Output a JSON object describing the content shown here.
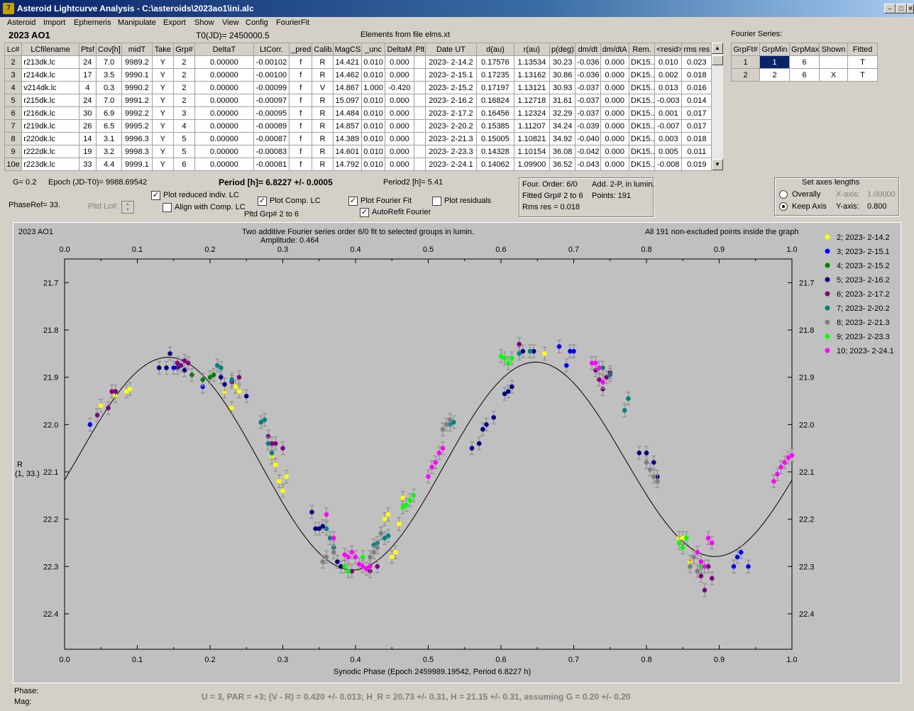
{
  "window": {
    "title": "Asteroid Lightcurve Analysis - C:\\asteroids\\2023ao1\\ini.alc",
    "icon_letter": "7"
  },
  "menu": [
    "Asteroid",
    "Import",
    "Ephemeris",
    "Manipulate",
    "Export",
    "Show",
    "View",
    "Config",
    "FourierFit"
  ],
  "header": {
    "object": "2023 AO1",
    "t0": "T0(JD)= 2450000.5",
    "elements": "Elements from file elms.xt"
  },
  "lc_table": {
    "columns": [
      "Lc#",
      "LCfilename",
      "Ptsf",
      "Cov[h]",
      "midT",
      "Take",
      "Grp#",
      "DeltaT",
      "LtCorr.",
      "_pred.",
      "Calib.",
      "MagCS",
      "_unc",
      "DeltaM",
      "Plt",
      "Date UT",
      "d(au)",
      "r(au)",
      "p(deg)",
      "dm/dt",
      "dm/dtA",
      "Rem.",
      "<resid>",
      "rms res"
    ],
    "rows": [
      [
        "2",
        "r213dk.lc",
        "24",
        "7.0",
        "9989.2",
        "Y",
        "2",
        "0.00000",
        "-0.00102",
        "f",
        "R",
        "14.421",
        "0.010",
        "0.000",
        "",
        "2023- 2-14.2",
        "0.17576",
        "1.13534",
        "30.23",
        "-0.036",
        "0.000",
        "DK15..",
        "0.010",
        "0.023"
      ],
      [
        "3",
        "r214dk.lc",
        "17",
        "3.5",
        "9990.1",
        "Y",
        "2",
        "0.00000",
        "-0.00100",
        "f",
        "R",
        "14.462",
        "0.010",
        "0.000",
        "",
        "2023- 2-15.1",
        "0.17235",
        "1.13162",
        "30.86",
        "-0.036",
        "0.000",
        "DK15..",
        "0.002",
        "0.018"
      ],
      [
        "4",
        "v214dk.lc",
        "4",
        "0.3",
        "9990.2",
        "Y",
        "2",
        "0.00000",
        "-0.00099",
        "f",
        "V",
        "14.867",
        "1.000",
        "-0.420",
        "",
        "2023- 2-15.2",
        "0.17197",
        "1.13121",
        "30.93",
        "-0.037",
        "0.000",
        "DK15..",
        "0.013",
        "0.016"
      ],
      [
        "5",
        "r215dk.lc",
        "24",
        "7.0",
        "9991.2",
        "Y",
        "2",
        "0.00000",
        "-0.00097",
        "f",
        "R",
        "15.097",
        "0.010",
        "0.000",
        "",
        "2023- 2-16.2",
        "0.16824",
        "1.12718",
        "31.61",
        "-0.037",
        "0.000",
        "DK15..",
        "-0.003",
        "0.014"
      ],
      [
        "6",
        "r216dk.lc",
        "30",
        "6.9",
        "9992.2",
        "Y",
        "3",
        "0.00000",
        "-0.00095",
        "f",
        "R",
        "14.484",
        "0.010",
        "0.000",
        "",
        "2023- 2-17.2",
        "0.16456",
        "1.12324",
        "32.29",
        "-0.037",
        "0.000",
        "DK15..",
        "0.001",
        "0.017"
      ],
      [
        "7",
        "r219dk.lc",
        "26",
        "6.5",
        "9995.2",
        "Y",
        "4",
        "0.00000",
        "-0.00089",
        "f",
        "R",
        "14.857",
        "0.010",
        "0.000",
        "",
        "2023- 2-20.2",
        "0.15385",
        "1.11207",
        "34.24",
        "-0.039",
        "0.000",
        "DK15..",
        "-0.007",
        "0.017"
      ],
      [
        "8",
        "r220dk.lc",
        "14",
        "3.1",
        "9996.3",
        "Y",
        "5",
        "0.00000",
        "-0.00087",
        "f",
        "R",
        "14.389",
        "0.010",
        "0.000",
        "",
        "2023- 2-21.3",
        "0.15005",
        "1.10821",
        "34.92",
        "-0.040",
        "0.000",
        "DK15..",
        "0.003",
        "0.018"
      ],
      [
        "9",
        "r222dk.lc",
        "19",
        "3.2",
        "9998.3",
        "Y",
        "5",
        "0.00000",
        "-0.00083",
        "f",
        "R",
        "14.601",
        "0.010",
        "0.000",
        "",
        "2023- 2-23.3",
        "0.14328",
        "1.10154",
        "36.08",
        "-0.042",
        "0.000",
        "DK15..",
        "0.005",
        "0.011"
      ],
      [
        "10e",
        "r223dk.lc",
        "33",
        "4.4",
        "9999.1",
        "Y",
        "6",
        "0.00000",
        "-0.00081",
        "f",
        "R",
        "14.792",
        "0.010",
        "0.000",
        "",
        "2023- 2-24.1",
        "0.14062",
        "1.09900",
        "36.52",
        "-0.043",
        "0.000",
        "DK15..",
        "-0.008",
        "0.019"
      ]
    ]
  },
  "fourier_table": {
    "title": "Fourier Series:",
    "columns": [
      "GrpFt#",
      "GrpMin",
      "GrpMax",
      "Shown",
      "Fitted"
    ],
    "rows": [
      [
        "1",
        "1",
        "6",
        "",
        "T"
      ],
      [
        "2",
        "2",
        "6",
        "X",
        "T"
      ]
    ]
  },
  "params": {
    "g": "G= 0.2",
    "epoch": "Epoch (JD-T0)= 9988.69542",
    "period": "Period [h]= 6.8227 +/- 0.0005",
    "period2": "Period2 [h]= 5.41",
    "phaseref": "PhaseRef= 33.",
    "pltd_lc": "Pltd Lc#:"
  },
  "checkboxes": {
    "plot_reduced": {
      "label": "Plot reduced indiv. LC",
      "checked": true
    },
    "align_comp": {
      "label": "Align with Comp. LC",
      "checked": false
    },
    "plot_comp": {
      "label": "Plot Comp. LC",
      "checked": true
    },
    "plot_fourier": {
      "label": "Plot Fourier Fit",
      "checked": true
    },
    "plot_residuals": {
      "label": "Plot residuals",
      "checked": false
    },
    "autorefit": {
      "label": "AutoRefit Fourier",
      "checked": true
    }
  },
  "pltd_grp": "Pltd Grp#  2  to   6",
  "fit_info": {
    "line1a": "Four. Order:  6/0",
    "line1b": "Add. 2-P, in lumin.",
    "line2a": "Fitted Grp# 2 to 6",
    "line2b": "Points: 191",
    "line3": "Rms res      = 0.018"
  },
  "axes_box": {
    "title": "Set axes lengths",
    "overall": "Overally",
    "keep": "Keep Axis",
    "x_label": "X-axis:",
    "x_value": "1.00000",
    "y_label": "Y-axis:",
    "y_value": "0.800"
  },
  "plot": {
    "name": "2023 AO1",
    "caption": "Two additive Fourier series order 6/0 fit to selected groups in lumin.",
    "amplitude": "Amplitude: 0.464",
    "points_note": "All 191 non-excluded points inside the graph",
    "xlabel": "Synodic Phase (Epoch 2459989.19542, Period 6.8227 h)",
    "ylabel_1": "R",
    "ylabel_2": "(1, 33.)"
  },
  "footer": {
    "phase": "Phase:",
    "mag": "Mag:",
    "summary": "U = 3, PAR = +3; (V - R) = 0.420 +/- 0.013; H_R = 20.73 +/- 0.31, H = 21.15 +/- 0.31, assuming G = 0.20 +/- 0.20"
  },
  "chart_data": {
    "type": "scatter",
    "x_ticks": [
      "0.0",
      "0.1",
      "0.2",
      "0.3",
      "0.4",
      "0.5",
      "0.6",
      "0.7",
      "0.8",
      "0.9",
      "1.0"
    ],
    "y_ticks": [
      "21.7",
      "21.8",
      "21.9",
      "22.0",
      "22.1",
      "22.2",
      "22.3",
      "22.4"
    ],
    "xlim": [
      0,
      1
    ],
    "ylim": [
      22.475,
      21.65
    ],
    "y_inverted": true,
    "legend_position": "right",
    "series": [
      {
        "name": "2; 2023- 2-14.2",
        "color": "#ffff00",
        "points": [
          [
            0.05,
            21.96
          ],
          [
            0.07,
            21.94
          ],
          [
            0.085,
            21.93
          ],
          [
            0.09,
            21.925
          ],
          [
            0.22,
            21.93
          ],
          [
            0.23,
            21.965
          ],
          [
            0.235,
            21.92
          ],
          [
            0.24,
            21.93
          ],
          [
            0.285,
            22.07
          ],
          [
            0.29,
            22.085
          ],
          [
            0.295,
            22.12
          ],
          [
            0.3,
            22.14
          ],
          [
            0.305,
            22.11
          ],
          [
            0.44,
            22.2
          ],
          [
            0.445,
            22.19
          ],
          [
            0.45,
            22.28
          ],
          [
            0.455,
            22.27
          ],
          [
            0.46,
            22.21
          ],
          [
            0.465,
            22.155
          ],
          [
            0.66,
            21.85
          ],
          [
            0.845,
            22.24
          ],
          [
            0.85,
            22.24
          ],
          [
            0.86,
            22.29
          ]
        ]
      },
      {
        "name": "3; 2023- 2-15.1",
        "color": "#0000ff",
        "points": [
          [
            0.035,
            22.0
          ],
          [
            0.15,
            21.88
          ],
          [
            0.19,
            21.92
          ],
          [
            0.68,
            21.835
          ],
          [
            0.69,
            21.875
          ],
          [
            0.695,
            21.845
          ],
          [
            0.7,
            21.845
          ],
          [
            0.92,
            22.3
          ],
          [
            0.925,
            22.28
          ],
          [
            0.93,
            22.27
          ],
          [
            0.94,
            22.3
          ]
        ]
      },
      {
        "name": "4; 2023- 2-15.2",
        "color": "#008000",
        "points": [
          [
            0.175,
            21.895
          ],
          [
            0.19,
            21.905
          ],
          [
            0.2,
            21.9
          ],
          [
            0.205,
            21.895
          ]
        ]
      },
      {
        "name": "5; 2023- 2-16.2",
        "color": "#000080",
        "points": [
          [
            0.13,
            21.88
          ],
          [
            0.14,
            21.88
          ],
          [
            0.145,
            21.85
          ],
          [
            0.155,
            21.88
          ],
          [
            0.165,
            21.885
          ],
          [
            0.215,
            21.9
          ],
          [
            0.22,
            21.915
          ],
          [
            0.25,
            21.94
          ],
          [
            0.34,
            22.185
          ],
          [
            0.345,
            22.22
          ],
          [
            0.35,
            22.22
          ],
          [
            0.355,
            22.215
          ],
          [
            0.375,
            22.29
          ],
          [
            0.38,
            22.3
          ],
          [
            0.56,
            22.05
          ],
          [
            0.57,
            22.04
          ],
          [
            0.575,
            22.01
          ],
          [
            0.58,
            22.0
          ],
          [
            0.59,
            21.985
          ],
          [
            0.605,
            21.935
          ],
          [
            0.61,
            21.93
          ],
          [
            0.615,
            21.92
          ],
          [
            0.63,
            21.845
          ],
          [
            0.645,
            21.845
          ],
          [
            0.79,
            22.06
          ],
          [
            0.8,
            22.06
          ],
          [
            0.81,
            22.08
          ],
          [
            0.815,
            22.11
          ]
        ]
      },
      {
        "name": "6; 2023- 2-17.2",
        "color": "#800080",
        "points": [
          [
            0.045,
            21.98
          ],
          [
            0.06,
            21.965
          ],
          [
            0.065,
            21.93
          ],
          [
            0.07,
            21.93
          ],
          [
            0.155,
            21.87
          ],
          [
            0.16,
            21.875
          ],
          [
            0.165,
            21.865
          ],
          [
            0.17,
            21.87
          ],
          [
            0.23,
            21.91
          ],
          [
            0.24,
            21.9
          ],
          [
            0.28,
            22.025
          ],
          [
            0.285,
            22.04
          ],
          [
            0.29,
            22.04
          ],
          [
            0.3,
            22.05
          ],
          [
            0.395,
            22.31
          ],
          [
            0.42,
            22.31
          ],
          [
            0.43,
            22.3
          ],
          [
            0.625,
            21.83
          ],
          [
            0.73,
            21.885
          ],
          [
            0.735,
            21.905
          ],
          [
            0.74,
            21.925
          ],
          [
            0.745,
            21.9
          ],
          [
            0.75,
            21.89
          ],
          [
            0.87,
            22.31
          ],
          [
            0.875,
            22.32
          ],
          [
            0.88,
            22.35
          ],
          [
            0.885,
            22.3
          ],
          [
            0.89,
            22.325
          ]
        ]
      },
      {
        "name": "7; 2023- 2-20.2",
        "color": "#008080",
        "points": [
          [
            0.21,
            21.875
          ],
          [
            0.215,
            21.88
          ],
          [
            0.23,
            21.905
          ],
          [
            0.27,
            21.995
          ],
          [
            0.275,
            21.99
          ],
          [
            0.28,
            22.04
          ],
          [
            0.285,
            22.06
          ],
          [
            0.36,
            22.22
          ],
          [
            0.365,
            22.24
          ],
          [
            0.37,
            22.26
          ],
          [
            0.425,
            22.255
          ],
          [
            0.43,
            22.25
          ],
          [
            0.435,
            22.23
          ],
          [
            0.44,
            22.24
          ],
          [
            0.445,
            22.235
          ],
          [
            0.53,
            22.0
          ],
          [
            0.535,
            21.995
          ],
          [
            0.625,
            21.85
          ],
          [
            0.64,
            21.845
          ],
          [
            0.74,
            21.88
          ],
          [
            0.75,
            21.895
          ],
          [
            0.77,
            21.97
          ],
          [
            0.775,
            21.945
          ]
        ]
      },
      {
        "name": "8; 2023- 2-21.3",
        "color": "#808080",
        "points": [
          [
            0.355,
            22.29
          ],
          [
            0.36,
            22.28
          ],
          [
            0.37,
            22.27
          ],
          [
            0.42,
            22.28
          ],
          [
            0.425,
            22.27
          ],
          [
            0.43,
            22.26
          ],
          [
            0.435,
            22.23
          ],
          [
            0.52,
            22.01
          ],
          [
            0.525,
            22.0
          ],
          [
            0.53,
            21.99
          ],
          [
            0.8,
            22.08
          ],
          [
            0.805,
            22.095
          ],
          [
            0.81,
            22.11
          ],
          [
            0.815,
            22.12
          ],
          [
            0.86,
            22.3
          ],
          [
            0.865,
            22.28
          ],
          [
            0.87,
            22.31
          ],
          [
            0.875,
            22.3
          ]
        ]
      },
      {
        "name": "9; 2023- 2-23.3",
        "color": "#00ff00",
        "points": [
          [
            0.385,
            22.3
          ],
          [
            0.39,
            22.31
          ],
          [
            0.41,
            22.28
          ],
          [
            0.47,
            22.17
          ],
          [
            0.475,
            22.16
          ],
          [
            0.48,
            22.15
          ],
          [
            0.465,
            22.175
          ],
          [
            0.6,
            21.855
          ],
          [
            0.605,
            21.86
          ],
          [
            0.61,
            21.87
          ],
          [
            0.615,
            21.86
          ],
          [
            0.845,
            22.25
          ],
          [
            0.85,
            22.26
          ],
          [
            0.855,
            22.24
          ],
          [
            0.875,
            22.3
          ]
        ]
      },
      {
        "name": "10; 2023- 2-24.1",
        "color": "#ff00ff",
        "points": [
          [
            0.36,
            22.19
          ],
          [
            0.37,
            22.24
          ],
          [
            0.385,
            22.275
          ],
          [
            0.39,
            22.28
          ],
          [
            0.395,
            22.27
          ],
          [
            0.4,
            22.28
          ],
          [
            0.405,
            22.295
          ],
          [
            0.41,
            22.3
          ],
          [
            0.415,
            22.305
          ],
          [
            0.42,
            22.3
          ],
          [
            0.5,
            22.11
          ],
          [
            0.505,
            22.09
          ],
          [
            0.51,
            22.08
          ],
          [
            0.515,
            22.06
          ],
          [
            0.52,
            22.05
          ],
          [
            0.725,
            21.87
          ],
          [
            0.73,
            21.87
          ],
          [
            0.735,
            21.88
          ],
          [
            0.74,
            21.91
          ],
          [
            0.87,
            22.27
          ],
          [
            0.875,
            22.29
          ],
          [
            0.88,
            22.3
          ],
          [
            0.885,
            22.24
          ],
          [
            0.89,
            22.25
          ],
          [
            0.975,
            22.12
          ],
          [
            0.98,
            22.105
          ],
          [
            0.985,
            22.09
          ],
          [
            0.99,
            22.08
          ],
          [
            0.995,
            22.07
          ],
          [
            1.0,
            22.065
          ]
        ]
      }
    ]
  }
}
